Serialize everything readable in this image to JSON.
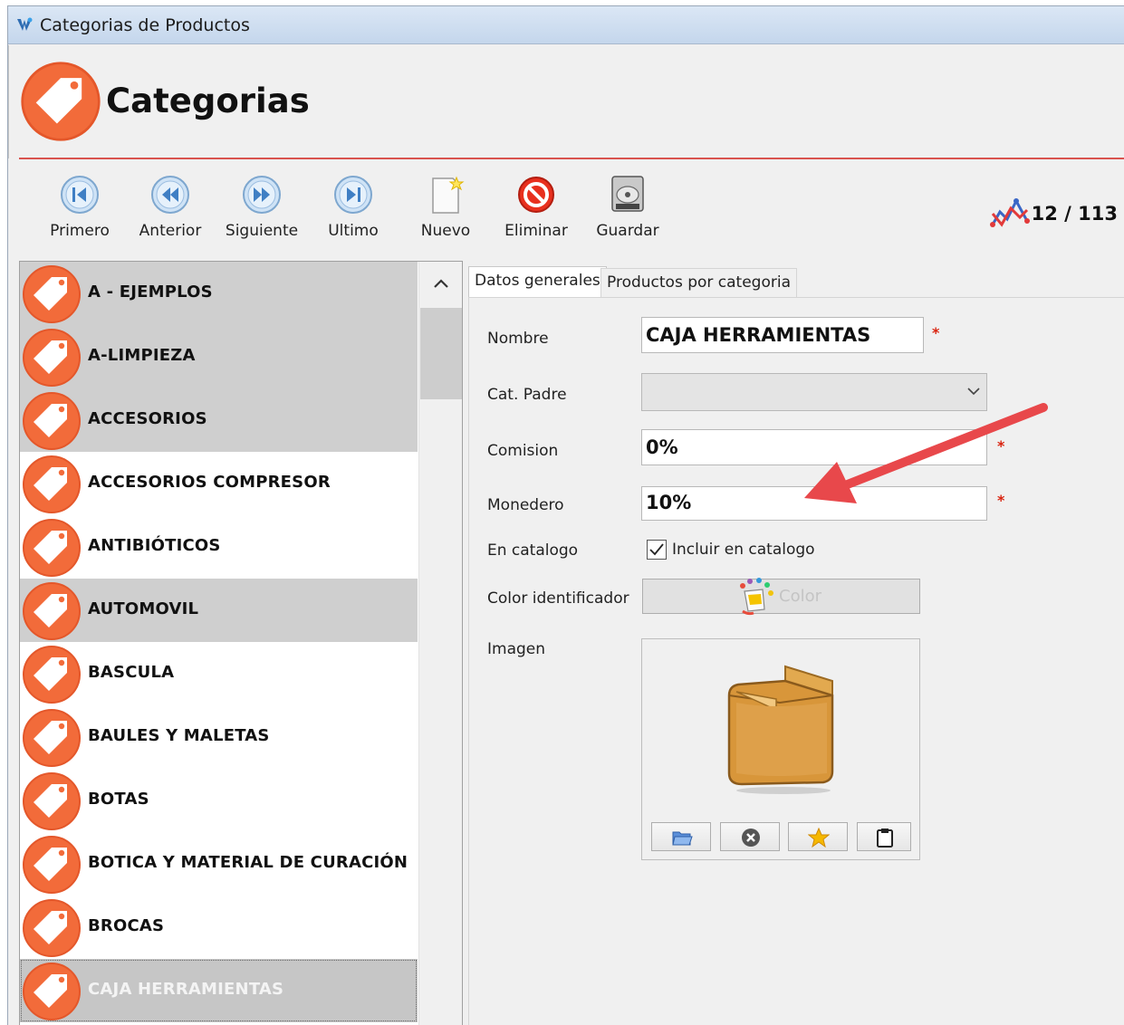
{
  "window": {
    "title": "Categorias de Productos"
  },
  "header": {
    "title": "Categorias"
  },
  "toolbar": {
    "first_label": "Primero",
    "prev_label": "Anterior",
    "next_label": "Siguiente",
    "last_label": "Ultimo",
    "new_label": "Nuevo",
    "delete_label": "Eliminar",
    "save_label": "Guardar"
  },
  "record_counter": {
    "text": "12 / 113"
  },
  "list": {
    "items": [
      {
        "label": "A - EJEMPLOS",
        "style": "gray"
      },
      {
        "label": "A-LIMPIEZA",
        "style": "gray"
      },
      {
        "label": "ACCESORIOS",
        "style": "gray"
      },
      {
        "label": "ACCESORIOS COMPRESOR",
        "style": "white"
      },
      {
        "label": "ANTIBIÓTICOS",
        "style": "white"
      },
      {
        "label": "AUTOMOVIL",
        "style": "gray"
      },
      {
        "label": "BASCULA",
        "style": "white"
      },
      {
        "label": "BAULES Y MALETAS",
        "style": "white"
      },
      {
        "label": "BOTAS",
        "style": "white"
      },
      {
        "label": "BOTICA Y MATERIAL DE CURACIÓN",
        "style": "white"
      },
      {
        "label": "BROCAS",
        "style": "white"
      },
      {
        "label": "CAJA HERRAMIENTAS",
        "style": "selected"
      }
    ]
  },
  "tabs": [
    {
      "label": "Datos generales",
      "active": true
    },
    {
      "label": "Productos por categoria",
      "active": false
    }
  ],
  "form": {
    "nombre_label": "Nombre",
    "nombre_value": "CAJA HERRAMIENTAS",
    "padre_label": "Cat. Padre",
    "padre_value": "",
    "comision_label": "Comision",
    "comision_value": "0%",
    "monedero_label": "Monedero",
    "monedero_value": "10%",
    "catalogo_label": "En catalogo",
    "catalogo_checkbox_label": "Incluir en catalogo",
    "catalogo_checked": true,
    "color_label": "Color identificador",
    "color_button_label": "Color",
    "imagen_label": "Imagen",
    "required_mark": "*"
  },
  "colors": {
    "accent_orange": "#f26b3a",
    "required_red": "#d9230f",
    "header_line": "#d9534f",
    "annotation_arrow": "#e8484b"
  },
  "icons": {
    "tag": "tag-icon",
    "first": "first-record-icon",
    "prev": "previous-record-icon",
    "next": "next-record-icon",
    "last": "last-record-icon",
    "new": "new-document-icon",
    "delete": "delete-icon",
    "save": "save-disk-icon",
    "counter": "line-chart-icon",
    "image_open": "open-folder-icon",
    "image_clear": "clear-icon",
    "image_star": "star-icon",
    "image_paste": "clipboard-icon"
  }
}
